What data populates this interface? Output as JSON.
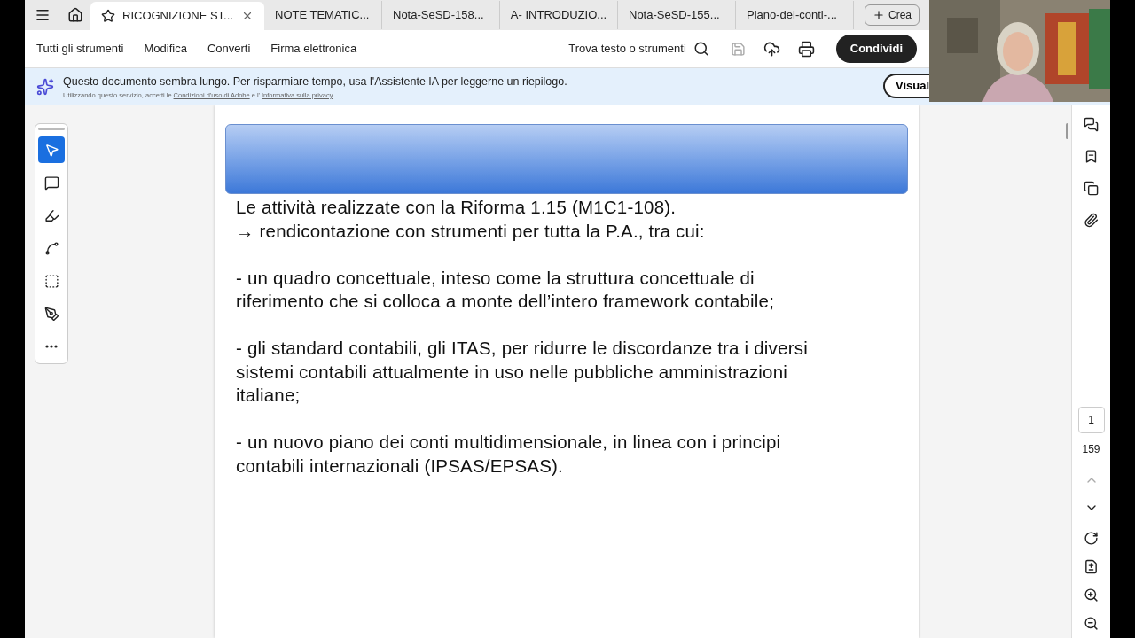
{
  "tabs": [
    {
      "label": "RICOGNIZIONE ST...",
      "selected": true
    },
    {
      "label": "NOTE TEMATIC...",
      "selected": false
    },
    {
      "label": "Nota-SeSD-158...",
      "selected": false
    },
    {
      "label": "A- INTRODUZIO...",
      "selected": false
    },
    {
      "label": "Nota-SeSD-155...",
      "selected": false
    },
    {
      "label": "Piano-dei-conti-...",
      "selected": false
    }
  ],
  "create_button": "Crea",
  "menu": [
    "Tutti gli strumenti",
    "Modifica",
    "Converti",
    "Firma elettronica"
  ],
  "search_label": "Trova testo o strumenti",
  "share_button": "Condividi",
  "banner": {
    "message": "Questo documento sembra lungo. Per risparmiare tempo, usa l'Assistente IA per leggerne un riepilogo.",
    "note": "Utilizzando questo servizio, accetti le",
    "terms_link": "Condizioni d'uso di Adobe",
    "and": "e l'",
    "privacy_link": "Informativa sulla privacy",
    "button": "Visual"
  },
  "tools": [
    {
      "kind": "select",
      "selected": true
    },
    {
      "kind": "comment",
      "selected": false
    },
    {
      "kind": "highlight",
      "selected": false
    },
    {
      "kind": "draw",
      "selected": false
    },
    {
      "kind": "text",
      "selected": false
    },
    {
      "kind": "sign",
      "selected": false
    },
    {
      "kind": "more",
      "selected": false
    }
  ],
  "document": {
    "paragraphs": [
      [
        "Le attività realizzate con la Riforma  1.15 (M1C1-108).",
        "→ rendicontazione con strumenti per tutta la P.A., tra cui:"
      ],
      [
        "- un quadro concettuale, inteso come la struttura concettuale di",
        "riferimento che si colloca a monte dell’intero framework contabile;"
      ],
      [
        "- gli standard contabili, gli ITAS, per ridurre le discordanze tra i diversi",
        "sistemi contabili attualmente in uso nelle pubbliche amministrazioni",
        "italiane;"
      ],
      [
        "- un nuovo piano dei conti multidimensionale, in linea con i principi",
        "contabili internazionali (IPSAS/EPSAS)."
      ]
    ]
  },
  "page": {
    "current": "1",
    "total": "159"
  }
}
